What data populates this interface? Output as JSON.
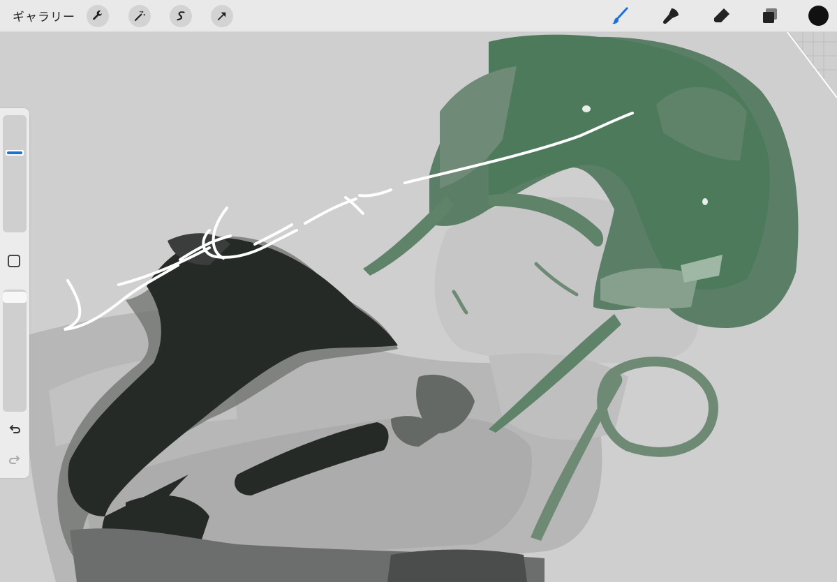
{
  "topbar": {
    "gallery_label": "ギャラリー",
    "left_tools": [
      "wrench-icon",
      "magic-wand-icon",
      "selection-icon",
      "transform-arrow-icon"
    ],
    "right_tools": [
      "brush-icon",
      "smudge-icon",
      "eraser-icon",
      "layers-icon"
    ],
    "active_tool": "brush-icon",
    "accent_color": "#1a72d8",
    "current_color": "#111111"
  },
  "sidebar": {
    "controls": [
      "brush-size-slider",
      "modify-square-button",
      "opacity-slider",
      "undo-icon",
      "redo-icon"
    ]
  },
  "canvas": {
    "background_color": "#cfcfcf",
    "hair_color": "#4f7a5c",
    "dark_color": "#262a27"
  }
}
